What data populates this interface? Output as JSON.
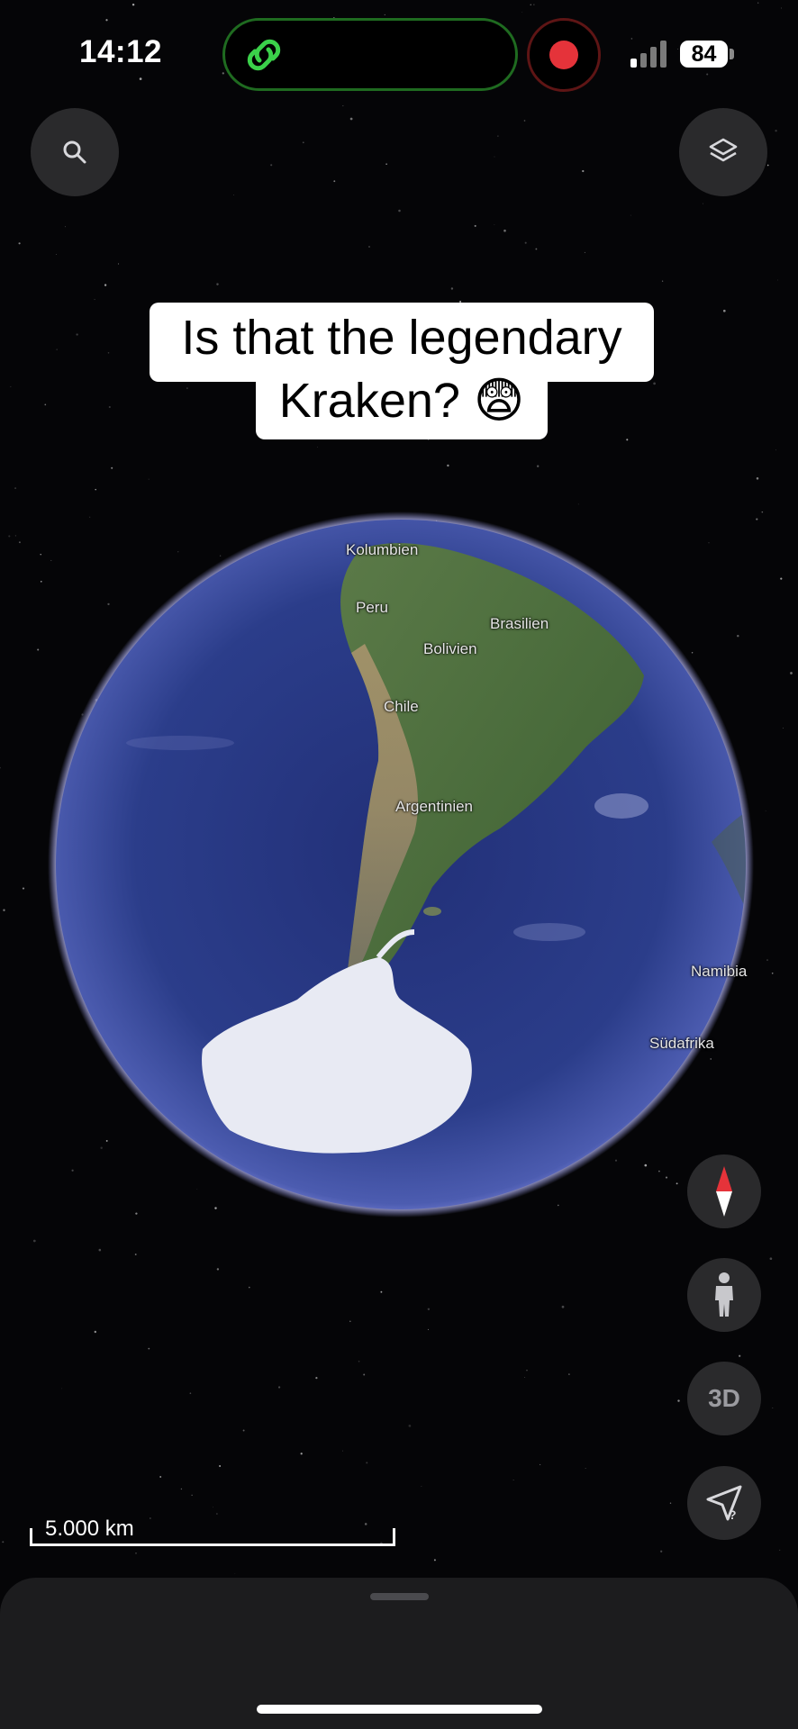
{
  "status_bar": {
    "time": "14:12",
    "battery": "84"
  },
  "caption": {
    "line1": "Is that the legendary",
    "line2": "Kraken? 😨"
  },
  "map": {
    "place_labels": {
      "kolumbien": "Kolumbien",
      "peru": "Peru",
      "brasilien": "Brasilien",
      "bolivien": "Bolivien",
      "chile": "Chile",
      "argentinien": "Argentinien",
      "namibia": "Namibia",
      "suedafrika": "Südafrika"
    },
    "scale": "5.000 km"
  },
  "controls": {
    "three_d": "3D"
  },
  "icons": {
    "search": "search-icon",
    "layers": "layers-icon",
    "compass": "compass-icon",
    "pegman": "pegman-icon",
    "locate": "locate-question-icon",
    "link": "link-icon"
  },
  "colors": {
    "ocean": "#2f3f8a",
    "land": "#4d6a3c",
    "ice": "#e8eaf3",
    "atmosphere": "#a6a8ff",
    "accent_green": "#3bd14a",
    "record_red": "#e5333a"
  }
}
